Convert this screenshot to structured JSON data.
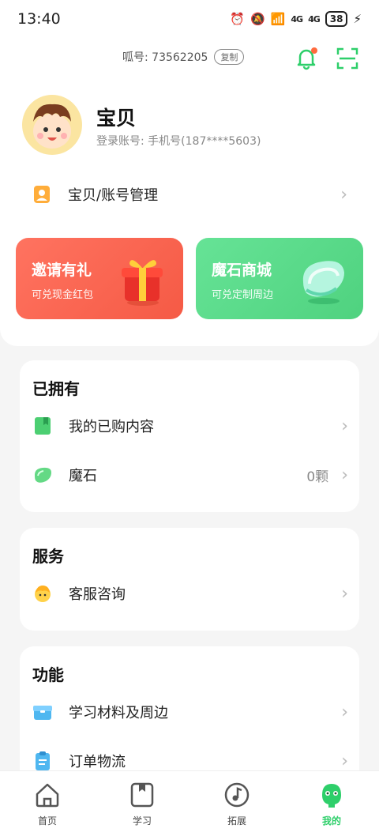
{
  "status": {
    "time": "13:40",
    "net1": "4G",
    "net2": "4G",
    "battery": "38",
    "wifi_badge": "6"
  },
  "header": {
    "id_label": "呱号: 73562205",
    "copy_label": "复制"
  },
  "profile": {
    "name": "宝贝",
    "login_account": "登录账号: 手机号(187****5603)"
  },
  "account_manage": {
    "label": "宝贝/账号管理"
  },
  "promos": {
    "invite": {
      "title": "邀请有礼",
      "subtitle": "可兑现金红包"
    },
    "shop": {
      "title": "魔石商城",
      "subtitle": "可兑定制周边"
    }
  },
  "owned": {
    "title": "已拥有",
    "items": [
      {
        "label": "我的已购内容"
      },
      {
        "label": "魔石",
        "value": "0颗"
      }
    ]
  },
  "services": {
    "title": "服务",
    "items": [
      {
        "label": "客服咨询"
      }
    ]
  },
  "functions": {
    "title": "功能",
    "items": [
      {
        "label": "学习材料及周边"
      },
      {
        "label": "订单物流"
      }
    ]
  },
  "tabs": [
    {
      "label": "首页",
      "icon": "home-icon"
    },
    {
      "label": "学习",
      "icon": "book-icon"
    },
    {
      "label": "拓展",
      "icon": "music-icon"
    },
    {
      "label": "我的",
      "icon": "frog-icon",
      "active": true
    }
  ],
  "colors": {
    "accent": "#2ecf6a",
    "invite_red": "#f55a45",
    "shop_green": "#4fd27f"
  }
}
